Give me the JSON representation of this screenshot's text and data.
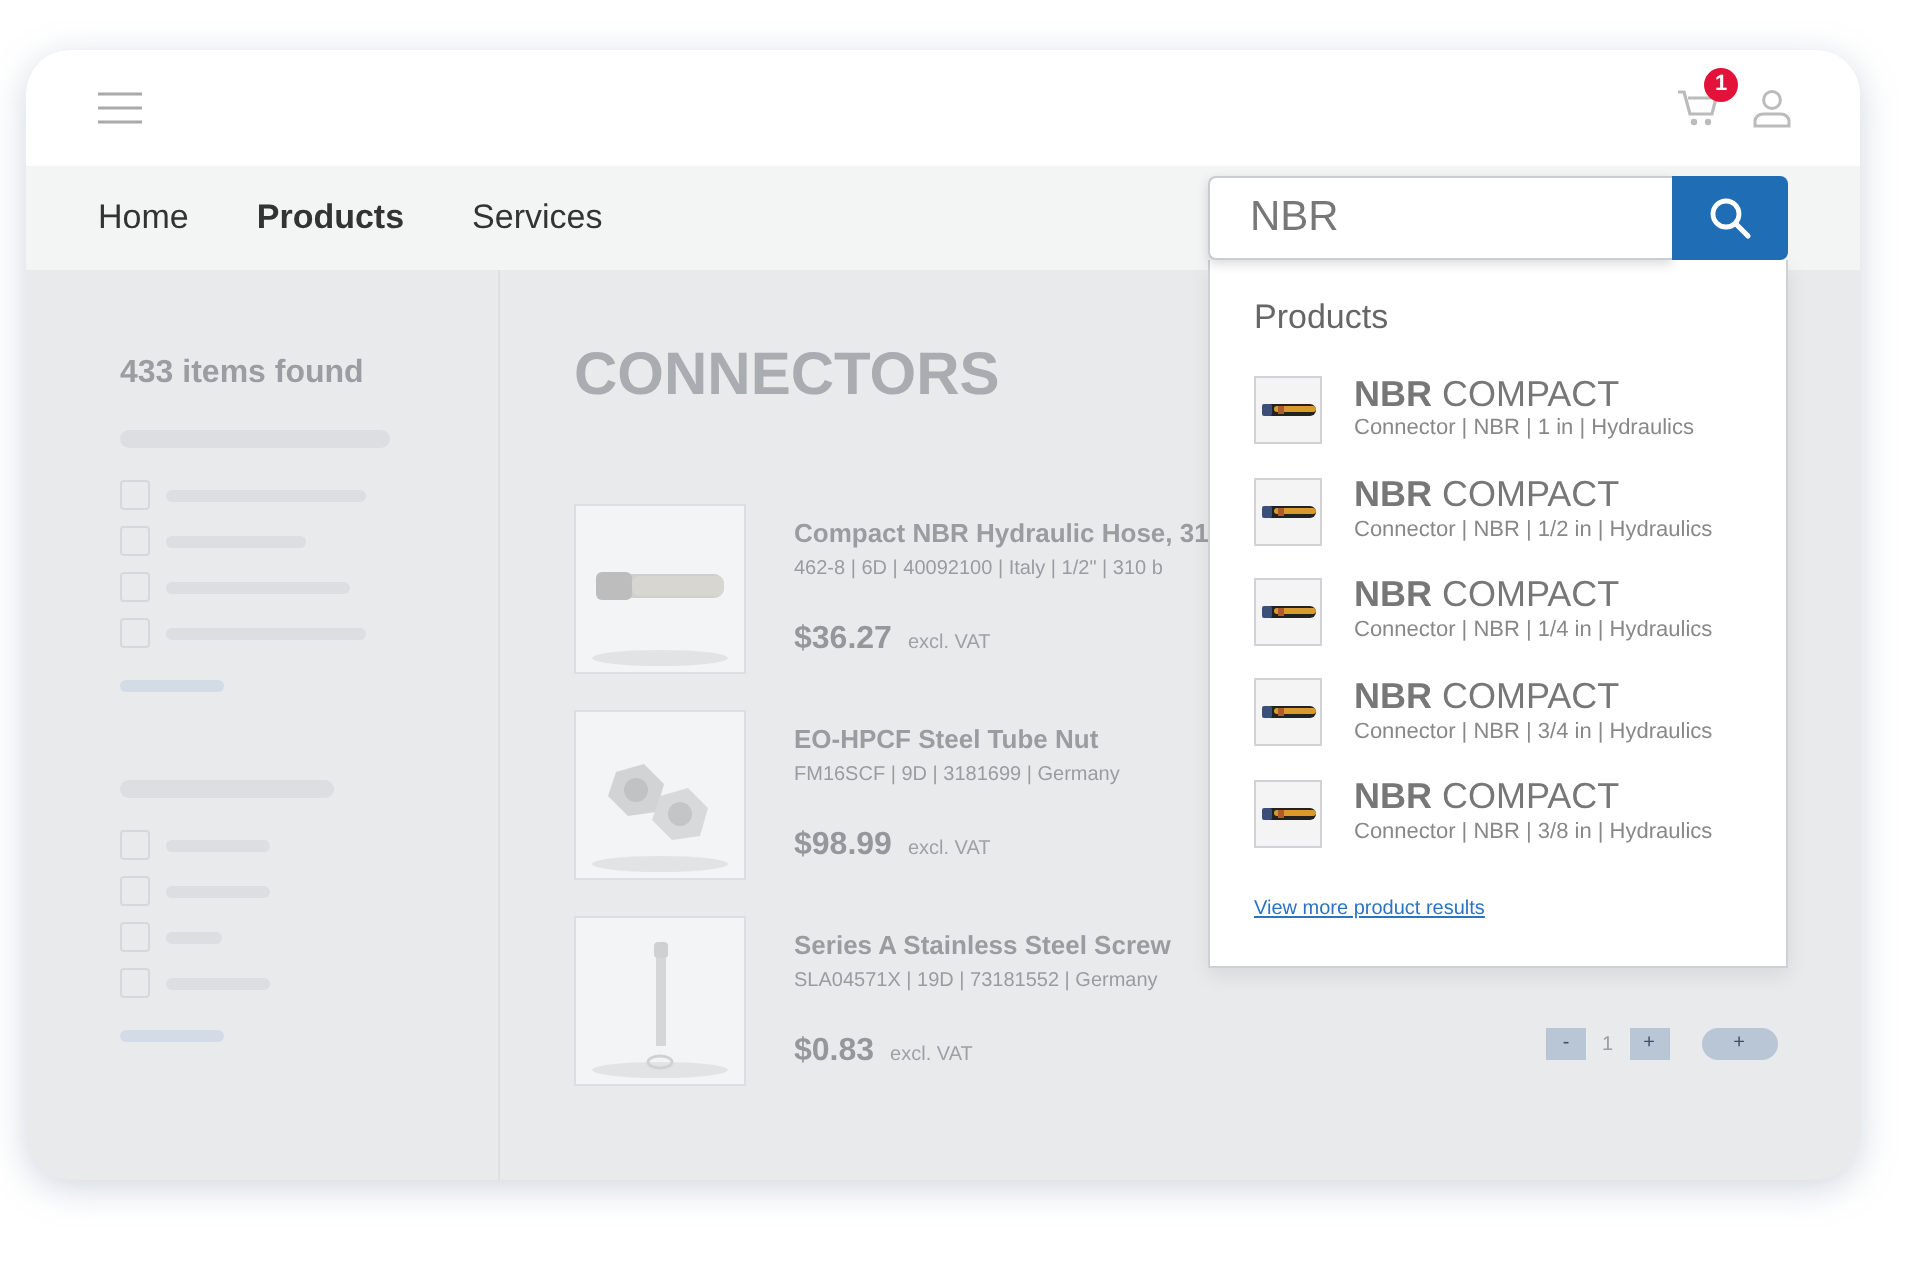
{
  "header": {
    "cart_count": "1"
  },
  "nav": [
    {
      "label": "Home",
      "selected": false
    },
    {
      "label": "Products",
      "selected": true
    },
    {
      "label": "Services",
      "selected": false
    }
  ],
  "search": {
    "value": "NBR"
  },
  "sidebar": {
    "count": "433 items found",
    "filter_groups": [
      {
        "options": [
          {
            "checked": false
          },
          {
            "checked": false
          },
          {
            "checked": false
          },
          {
            "checked": false
          }
        ]
      },
      {
        "options": [
          {
            "checked": false
          },
          {
            "checked": false
          },
          {
            "checked": false
          },
          {
            "checked": false
          }
        ]
      }
    ]
  },
  "main": {
    "title": "CONNECTORS",
    "products": [
      {
        "kind": "hose",
        "name": "Compact NBR Hydraulic Hose, 31",
        "specs": "462-8 | 6D | 40092100 | Italy | 1/2\" | 310 b",
        "price": "$36.27",
        "tax": "excl. VAT"
      },
      {
        "kind": "nut",
        "name": "EO-HPCF Steel Tube Nut",
        "specs": "FM16SCF | 9D | 3181699 | Germany",
        "price": "$98.99",
        "tax": "excl. VAT"
      },
      {
        "kind": "screw",
        "name": "Series A Stainless Steel Screw",
        "specs": "SLA04571X | 19D | 73181552 | Germany",
        "price": "$0.83",
        "tax": "excl. VAT"
      }
    ],
    "quantity": {
      "minus": "-",
      "value": "1",
      "plus": "+",
      "add": "+"
    }
  },
  "dropdown": {
    "heading": "Products",
    "results": [
      {
        "match": "NBR",
        "rest": "COMPACT",
        "details": "Connector | NBR | 1 in | Hydraulics"
      },
      {
        "match": "NBR",
        "rest": "COMPACT",
        "details": "Connector | NBR | 1/2 in | Hydraulics"
      },
      {
        "match": "NBR",
        "rest": "COMPACT",
        "details": "Connector | NBR | 1/4 in | Hydraulics"
      },
      {
        "match": "NBR",
        "rest": "COMPACT",
        "details": "Connector | NBR | 3/4 in | Hydraulics"
      },
      {
        "match": "NBR",
        "rest": "COMPACT",
        "details": "Connector | NBR | 3/8 in | Hydraulics"
      }
    ],
    "more_link": "View more product results"
  }
}
